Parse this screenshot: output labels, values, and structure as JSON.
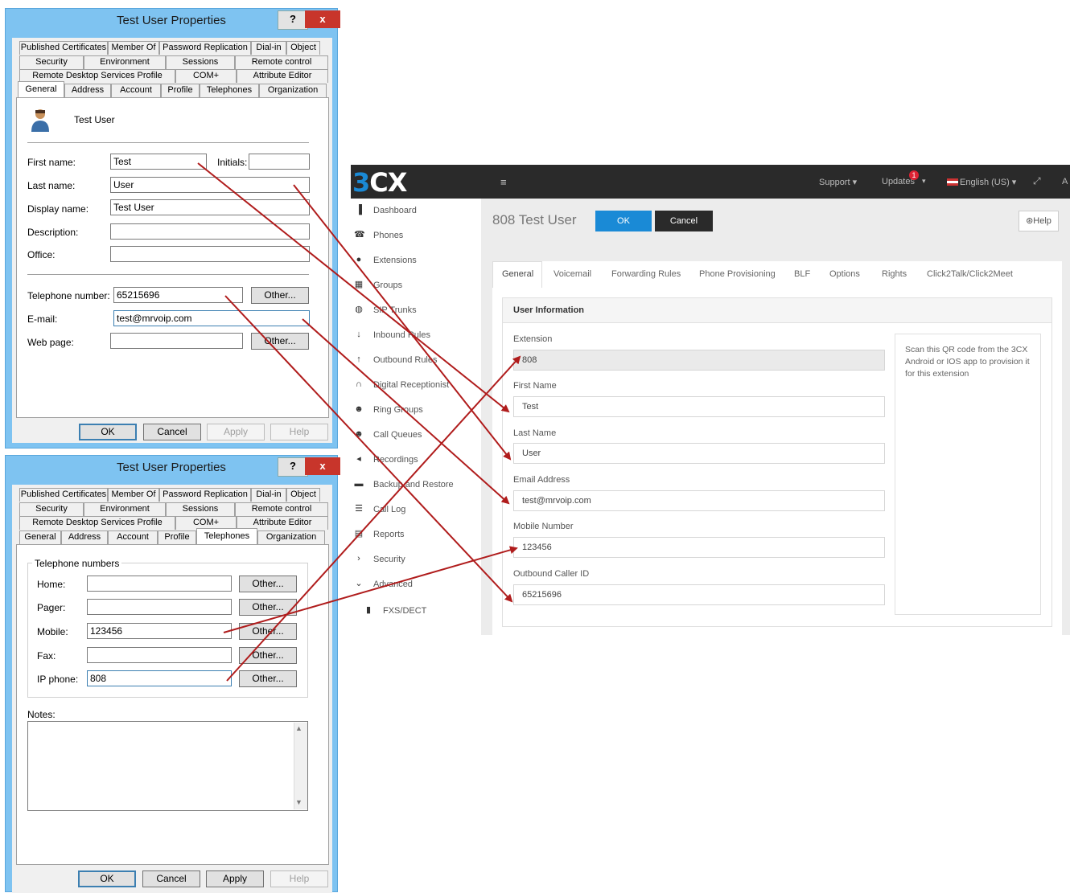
{
  "dialog_top": {
    "title": "Test User Properties",
    "help": "?",
    "close": "x",
    "tabs_row1": [
      "Published Certificates",
      "Member Of",
      "Password Replication",
      "Dial-in",
      "Object"
    ],
    "tabs_row2": [
      "Security",
      "Environment",
      "Sessions",
      "Remote control"
    ],
    "tabs_row3": [
      "Remote Desktop Services Profile",
      "COM+",
      "Attribute Editor"
    ],
    "tabs_row4": [
      "General",
      "Address",
      "Account",
      "Profile",
      "Telephones",
      "Organization"
    ],
    "selected_tab": "General",
    "user_display": "Test User",
    "labels": {
      "first_name": "First name:",
      "initials": "Initials:",
      "last_name": "Last name:",
      "display_name": "Display name:",
      "description": "Description:",
      "office": "Office:",
      "telephone": "Telephone number:",
      "email": "E-mail:",
      "web_page": "Web page:"
    },
    "values": {
      "first_name": "Test",
      "initials": "",
      "last_name": "User",
      "display_name": "Test User",
      "description": "",
      "office": "",
      "telephone": "65215696",
      "email": "test@mrvoip.com",
      "web_page": ""
    },
    "other_btn": "Other...",
    "buttons": {
      "ok": "OK",
      "cancel": "Cancel",
      "apply": "Apply",
      "help": "Help"
    }
  },
  "dialog_bottom": {
    "title": "Test User Properties",
    "help": "?",
    "close": "x",
    "tabs_row1": [
      "Published Certificates",
      "Member Of",
      "Password Replication",
      "Dial-in",
      "Object"
    ],
    "tabs_row2": [
      "Security",
      "Environment",
      "Sessions",
      "Remote control"
    ],
    "tabs_row3": [
      "Remote Desktop Services Profile",
      "COM+",
      "Attribute Editor"
    ],
    "tabs_row4": [
      "General",
      "Address",
      "Account",
      "Profile",
      "Telephones",
      "Organization"
    ],
    "selected_tab": "Telephones",
    "group_title": "Telephone numbers",
    "labels": {
      "home": "Home:",
      "pager": "Pager:",
      "mobile": "Mobile:",
      "fax": "Fax:",
      "ip_phone": "IP phone:",
      "notes": "Notes:"
    },
    "values": {
      "home": "",
      "pager": "",
      "mobile": "123456",
      "fax": "",
      "ip_phone": "808",
      "notes": ""
    },
    "other_btn": "Other...",
    "buttons": {
      "ok": "OK",
      "cancel": "Cancel",
      "apply": "Apply",
      "help": "Help"
    }
  },
  "threecx": {
    "logo": "3CX",
    "topbar": {
      "support": "Support ▾",
      "updates": "Updates",
      "updates_badge": "1",
      "language": "English (US) ▾",
      "account_initial": "A"
    },
    "sidebar": [
      {
        "label": "Dashboard",
        "icon": "bar-chart-icon"
      },
      {
        "label": "Phones",
        "icon": "phone-icon"
      },
      {
        "label": "Extensions",
        "icon": "user-icon"
      },
      {
        "label": "Groups",
        "icon": "grid-icon"
      },
      {
        "label": "SIP Trunks",
        "icon": "globe-icon"
      },
      {
        "label": "Inbound Rules",
        "icon": "arrow-down-icon"
      },
      {
        "label": "Outbound Rules",
        "icon": "arrow-up-icon"
      },
      {
        "label": "Digital Receptionist",
        "icon": "headset-icon"
      },
      {
        "label": "Ring Groups",
        "icon": "users-icon"
      },
      {
        "label": "Call Queues",
        "icon": "users-icon"
      },
      {
        "label": "Recordings",
        "icon": "speaker-icon"
      },
      {
        "label": "Backup and Restore",
        "icon": "folder-icon"
      },
      {
        "label": "Call Log",
        "icon": "list-icon"
      },
      {
        "label": "Reports",
        "icon": "report-icon"
      },
      {
        "label": "Security",
        "icon": "chevron-right-icon"
      },
      {
        "label": "Advanced",
        "icon": "chevron-down-icon"
      },
      {
        "label": "FXS/DECT",
        "icon": "fxs-icon"
      }
    ],
    "page_title": "808 Test User",
    "ok": "OK",
    "cancel": "Cancel",
    "help": "Help",
    "tabs": [
      "General",
      "Voicemail",
      "Forwarding Rules",
      "Phone Provisioning",
      "BLF",
      "Options",
      "Rights",
      "Click2Talk/Click2Meet"
    ],
    "selected_tab": "General",
    "section_title": "User Information",
    "fields": [
      {
        "label": "Extension",
        "value": "808"
      },
      {
        "label": "First Name",
        "value": "Test"
      },
      {
        "label": "Last Name",
        "value": "User"
      },
      {
        "label": "Email Address",
        "value": "test@mrvoip.com"
      },
      {
        "label": "Mobile Number",
        "value": "123456"
      },
      {
        "label": "Outbound Caller ID",
        "value": "65215696"
      }
    ],
    "qr_text": "Scan this QR code from the 3CX Android or IOS app to provision it for this extension"
  },
  "colors": {
    "arrow": "#b01c1c",
    "title_bar": "#7ec3f1",
    "cx_blue": "#1a8ad6",
    "cx_dark": "#2a2a2a"
  }
}
